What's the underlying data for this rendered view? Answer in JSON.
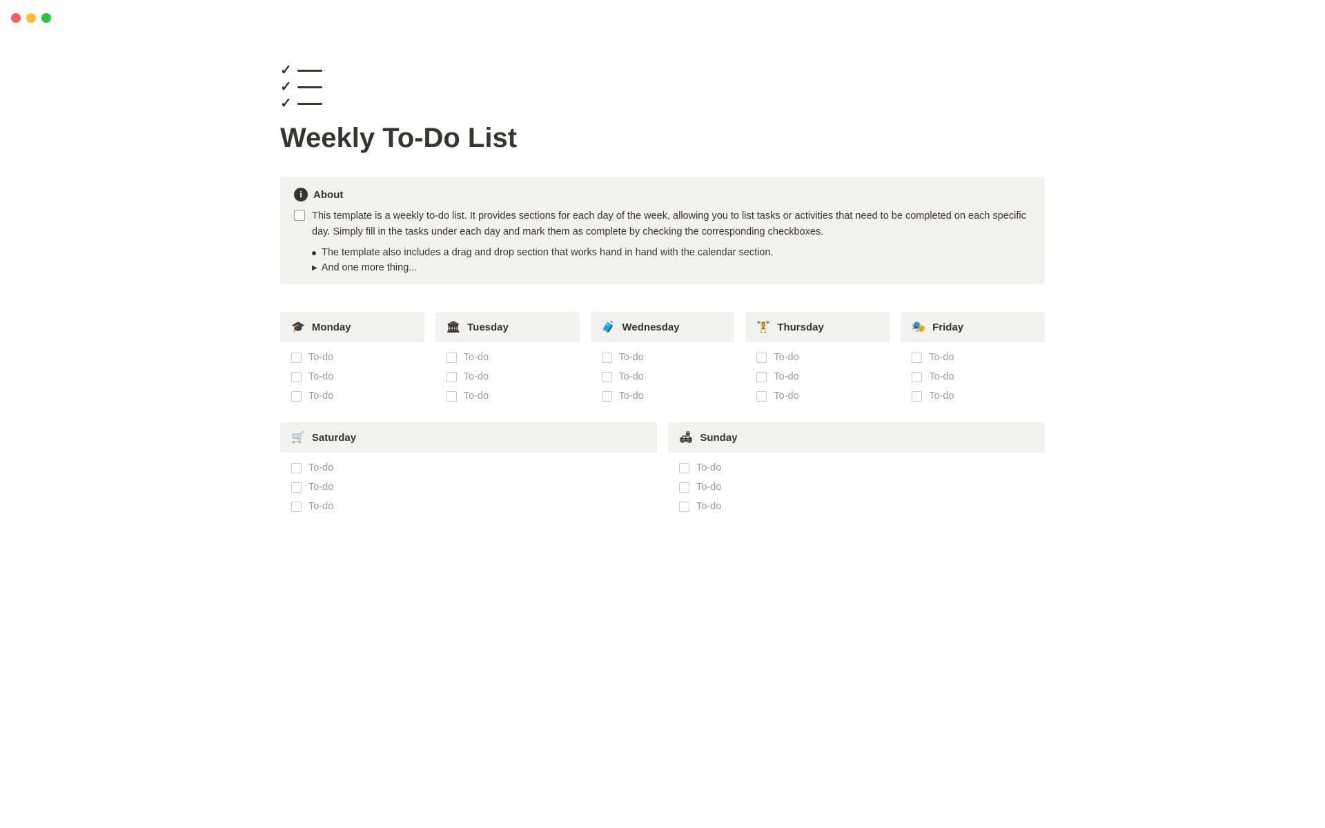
{
  "titlebar": {
    "traffic_lights": [
      "red",
      "yellow",
      "green"
    ]
  },
  "page": {
    "title": "Weekly To-Do List",
    "icon_label": "checklist-icon"
  },
  "about": {
    "header": "About",
    "info_icon": "i",
    "description": "This template is a weekly to-do list. It provides sections for each day of the week, allowing you to list tasks or activities that need to be completed on each specific day. Simply fill in the tasks under each day and mark them as complete by checking the corresponding checkboxes.",
    "bullet": "The template also includes a drag and drop section that works hand in hand with the calendar section.",
    "toggle": "And one more thing..."
  },
  "days_top": [
    {
      "name": "Monday",
      "icon": "🎓",
      "tasks": [
        "To-do",
        "To-do",
        "To-do"
      ]
    },
    {
      "name": "Tuesday",
      "icon": "🏛",
      "tasks": [
        "To-do",
        "To-do",
        "To-do"
      ]
    },
    {
      "name": "Wednesday",
      "icon": "🧳",
      "tasks": [
        "To-do",
        "To-do",
        "To-do"
      ]
    },
    {
      "name": "Thursday",
      "icon": "🏋",
      "tasks": [
        "To-do",
        "To-do",
        "To-do"
      ]
    },
    {
      "name": "Friday",
      "icon": "🎭",
      "tasks": [
        "To-do",
        "To-do",
        "To-do"
      ]
    }
  ],
  "days_bottom": [
    {
      "name": "Saturday",
      "icon": "🛒",
      "tasks": [
        "To-do",
        "To-do",
        "To-do"
      ]
    },
    {
      "name": "Sunday",
      "icon": "🛋",
      "tasks": [
        "To-do",
        "To-do",
        "To-do"
      ]
    }
  ]
}
